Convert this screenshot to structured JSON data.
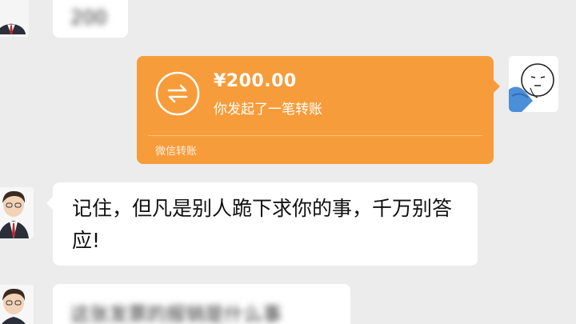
{
  "chat": {
    "top_bubble_text": "200",
    "transfer": {
      "amount": "¥200.00",
      "description": "你发起了一笔转账",
      "footer": "微信转账",
      "color": "#f79c3a",
      "icon": "transfer-arrows-icon"
    },
    "message_text": "记住，但凡是别人跪下求你的事，千万别答应!",
    "bottom_bubble_text": "这张发票的报销是什么事"
  }
}
